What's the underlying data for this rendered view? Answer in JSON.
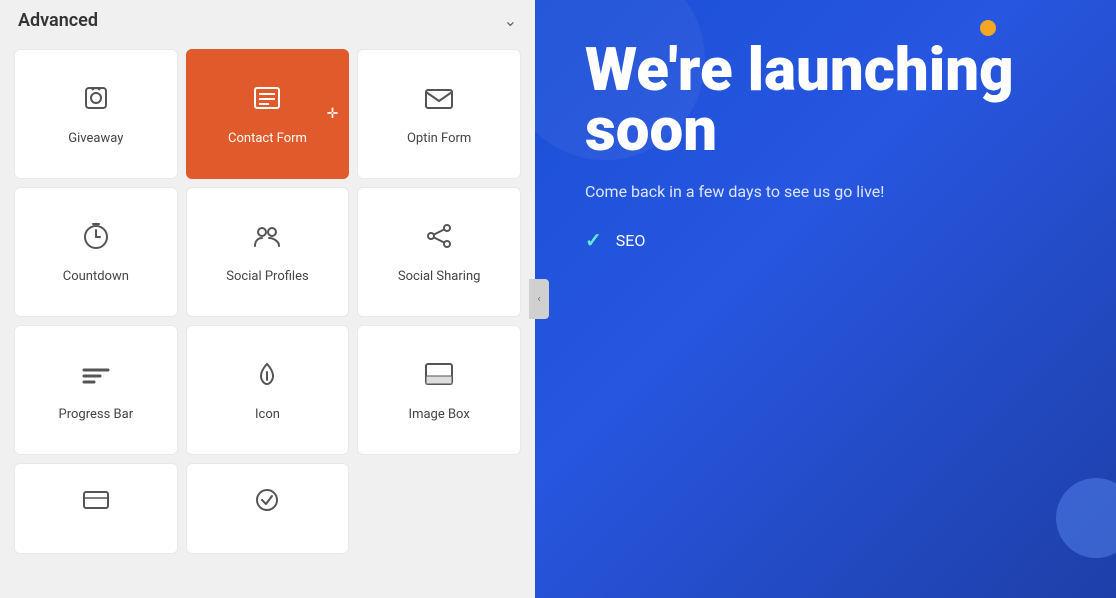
{
  "panel": {
    "title": "Advanced",
    "collapse_label": "‹"
  },
  "widgets": [
    {
      "id": "giveaway",
      "label": "Giveaway",
      "icon": "giveaway",
      "active": false
    },
    {
      "id": "contact-form",
      "label": "Contact Form",
      "icon": "contact-form",
      "active": true
    },
    {
      "id": "optin-form",
      "label": "Optin Form",
      "icon": "optin-form",
      "active": false
    },
    {
      "id": "countdown",
      "label": "Countdown",
      "icon": "countdown",
      "active": false
    },
    {
      "id": "social-profiles",
      "label": "Social Profiles",
      "icon": "social-profiles",
      "active": false
    },
    {
      "id": "social-sharing",
      "label": "Social Sharing",
      "icon": "social-sharing",
      "active": false
    },
    {
      "id": "progress-bar",
      "label": "Progress Bar",
      "icon": "progress-bar",
      "active": false
    },
    {
      "id": "icon",
      "label": "Icon",
      "icon": "icon",
      "active": false
    },
    {
      "id": "image-box",
      "label": "Image Box",
      "icon": "image-box",
      "active": false
    },
    {
      "id": "partial-1",
      "label": "",
      "icon": "partial",
      "active": false
    },
    {
      "id": "partial-2",
      "label": "",
      "icon": "partial2",
      "active": false
    }
  ],
  "hero": {
    "title": "We're launching soon",
    "subtitle": "Come back in a few days to see us go live!",
    "features": [
      {
        "id": "seo",
        "label": "SEO"
      }
    ]
  }
}
